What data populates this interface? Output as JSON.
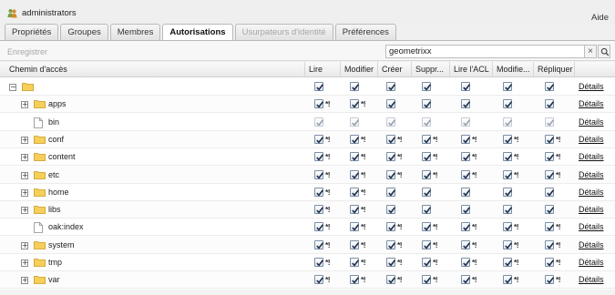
{
  "header": {
    "title": "administrators",
    "help": "Aide",
    "user_icon": "user-group-icon"
  },
  "tabs": [
    {
      "label": "Propriétés",
      "state": "normal"
    },
    {
      "label": "Groupes",
      "state": "normal"
    },
    {
      "label": "Membres",
      "state": "normal"
    },
    {
      "label": "Autorisations",
      "state": "active"
    },
    {
      "label": "Usurpateurs d'identité",
      "state": "disabled"
    },
    {
      "label": "Préférences",
      "state": "normal"
    }
  ],
  "toolbar": {
    "save_label": "Enregistrer",
    "search_value": "geometrixx",
    "clear_label": "×"
  },
  "columns": [
    "Chemin d'accès",
    "Lire",
    "Modifier",
    "Créer",
    "Suppr...",
    "Lire l'ACL",
    "Modifie...",
    "Répliquer",
    ""
  ],
  "details_label": "Détails",
  "marker": "*!",
  "rows": [
    {
      "name": "",
      "level": 0,
      "expander": "−",
      "icon": "folder",
      "perms": [
        "c",
        "c",
        "c",
        "c",
        "c",
        "c",
        "c"
      ]
    },
    {
      "name": "apps",
      "level": 1,
      "expander": "+",
      "icon": "folder",
      "perms": [
        "m",
        "m",
        "c",
        "c",
        "c",
        "c",
        "c"
      ]
    },
    {
      "name": "bin",
      "level": 1,
      "expander": "",
      "icon": "file",
      "perms": [
        "d",
        "d",
        "d",
        "d",
        "d",
        "d",
        "d"
      ]
    },
    {
      "name": "conf",
      "level": 1,
      "expander": "+",
      "icon": "folder",
      "perms": [
        "m",
        "m",
        "m",
        "m",
        "m",
        "m",
        "m"
      ]
    },
    {
      "name": "content",
      "level": 1,
      "expander": "+",
      "icon": "folder",
      "perms": [
        "m",
        "m",
        "m",
        "m",
        "m",
        "m",
        "m"
      ]
    },
    {
      "name": "etc",
      "level": 1,
      "expander": "+",
      "icon": "folder",
      "perms": [
        "m",
        "m",
        "m",
        "m",
        "m",
        "m",
        "m"
      ]
    },
    {
      "name": "home",
      "level": 1,
      "expander": "+",
      "icon": "folder",
      "perms": [
        "m",
        "m",
        "c",
        "c",
        "c",
        "c",
        "c"
      ]
    },
    {
      "name": "libs",
      "level": 1,
      "expander": "+",
      "icon": "folder",
      "perms": [
        "m",
        "m",
        "c",
        "c",
        "c",
        "c",
        "c"
      ]
    },
    {
      "name": "oak:index",
      "level": 1,
      "expander": "",
      "icon": "file",
      "perms": [
        "m",
        "m",
        "m",
        "m",
        "m",
        "m",
        "m"
      ]
    },
    {
      "name": "system",
      "level": 1,
      "expander": "+",
      "icon": "folder",
      "perms": [
        "m",
        "m",
        "m",
        "m",
        "m",
        "m",
        "m"
      ]
    },
    {
      "name": "tmp",
      "level": 1,
      "expander": "+",
      "icon": "folder",
      "perms": [
        "m",
        "m",
        "m",
        "m",
        "m",
        "m",
        "m"
      ]
    },
    {
      "name": "var",
      "level": 1,
      "expander": "+",
      "icon": "folder",
      "perms": [
        "m",
        "m",
        "m",
        "m",
        "m",
        "m",
        "m"
      ]
    }
  ],
  "colors": {
    "folder": "#f3c64a",
    "check": "#1f2f4a",
    "link": "#111111"
  }
}
